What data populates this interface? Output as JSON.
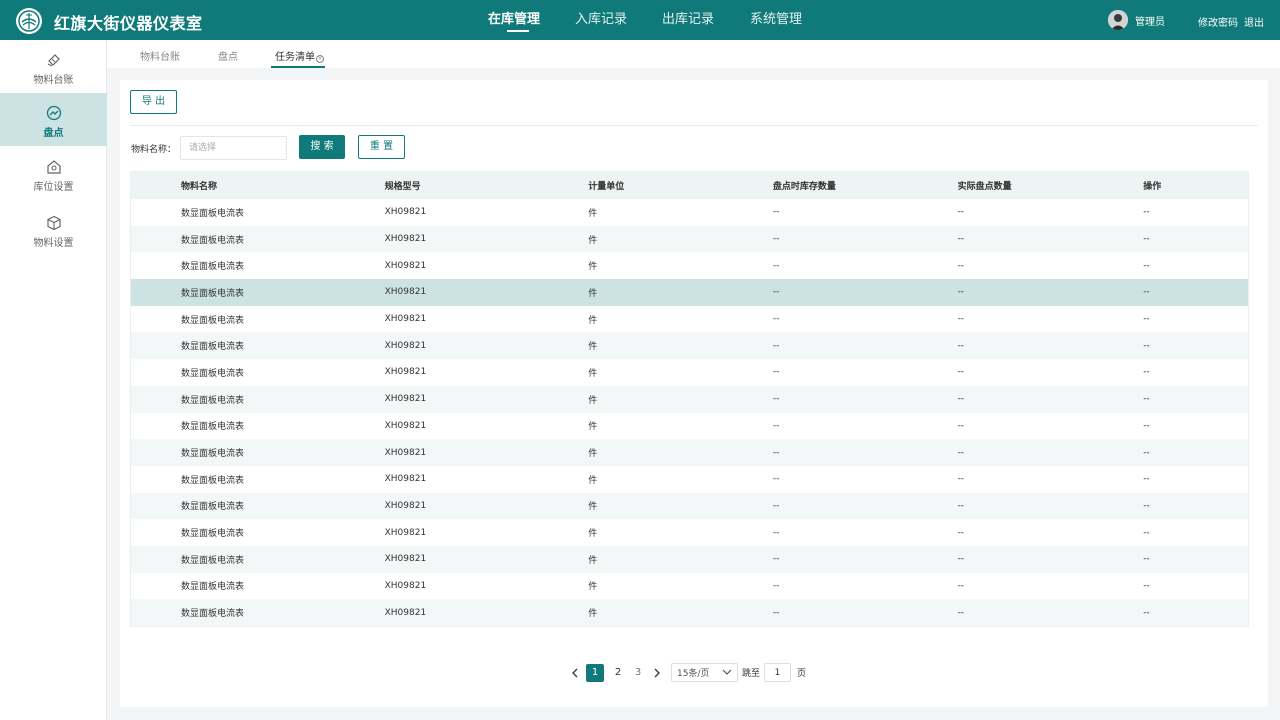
{
  "header": {
    "title": "红旗大街仪器仪表室",
    "nav": [
      "在库管理",
      "入库记录",
      "出库记录",
      "系统管理"
    ],
    "user_name": "管理员",
    "change_password": "修改密码",
    "logout": "退出"
  },
  "sidebar": {
    "items": [
      {
        "label": "物料台账",
        "icon": "ledger-icon"
      },
      {
        "label": "盘点",
        "icon": "trend-chart-icon"
      },
      {
        "label": "库位设置",
        "icon": "warehouse-location-icon"
      },
      {
        "label": "物料设置",
        "icon": "cube-icon"
      }
    ]
  },
  "tabs": [
    "物料台账",
    "盘点",
    "任务清单"
  ],
  "toolbar": {
    "export_label": "导 出",
    "filter_label": "物料名称：",
    "filter_placeholder": "请选择",
    "search_label": "搜 索",
    "reset_label": "重 置"
  },
  "table": {
    "columns": [
      "物料名称",
      "规格型号",
      "计量单位",
      "盘点时库存数量",
      "实际盘点数量",
      "操作"
    ],
    "rows": [
      [
        "数显面板电流表",
        "XH09821",
        "件",
        "--",
        "--",
        "--"
      ],
      [
        "数显面板电流表",
        "XH09821",
        "件",
        "--",
        "--",
        "--"
      ],
      [
        "数显面板电流表",
        "XH09821",
        "件",
        "--",
        "--",
        "--"
      ],
      [
        "数显面板电流表",
        "XH09821",
        "件",
        "--",
        "--",
        "--"
      ],
      [
        "数显面板电流表",
        "XH09821",
        "件",
        "--",
        "--",
        "--"
      ],
      [
        "数显面板电流表",
        "XH09821",
        "件",
        "--",
        "--",
        "--"
      ],
      [
        "数显面板电流表",
        "XH09821",
        "件",
        "--",
        "--",
        "--"
      ],
      [
        "数显面板电流表",
        "XH09821",
        "件",
        "--",
        "--",
        "--"
      ],
      [
        "数显面板电流表",
        "XH09821",
        "件",
        "--",
        "--",
        "--"
      ],
      [
        "数显面板电流表",
        "XH09821",
        "件",
        "--",
        "--",
        "--"
      ],
      [
        "数显面板电流表",
        "XH09821",
        "件",
        "--",
        "--",
        "--"
      ],
      [
        "数显面板电流表",
        "XH09821",
        "件",
        "--",
        "--",
        "--"
      ],
      [
        "数显面板电流表",
        "XH09821",
        "件",
        "--",
        "--",
        "--"
      ],
      [
        "数显面板电流表",
        "XH09821",
        "件",
        "--",
        "--",
        "--"
      ],
      [
        "数显面板电流表",
        "XH09821",
        "件",
        "--",
        "--",
        "--"
      ],
      [
        "数显面板电流表",
        "XH09821",
        "件",
        "--",
        "--",
        "--"
      ]
    ]
  },
  "pagination": {
    "pages": [
      "1",
      "2",
      "3"
    ],
    "current_page": "1",
    "page_size": "15条/页",
    "jump_label": "跳至",
    "jump_value": "1",
    "page_suffix": "页"
  },
  "colors": {
    "primary": "#0f7a79",
    "highlight_row": "#cde3e3",
    "header_bg": "#0f7a79"
  }
}
